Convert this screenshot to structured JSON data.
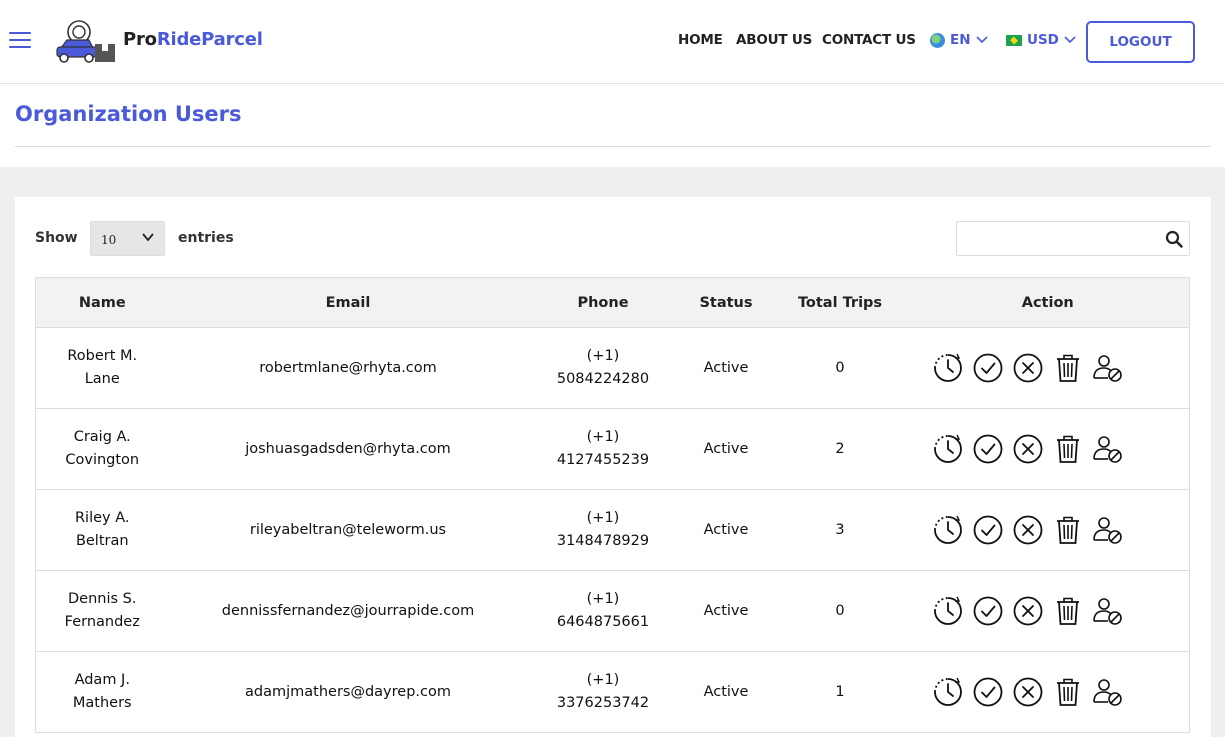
{
  "header": {
    "logo_pre": "Pro",
    "logo_post": "RideParcel",
    "nav": {
      "home": "HOME",
      "about": "ABOUT US",
      "contact": "CONTACT US"
    },
    "language": "EN",
    "currency": "USD",
    "logout": "LOGOUT"
  },
  "page": {
    "title": "Organization Users"
  },
  "controls": {
    "show_label": "Show",
    "entries_value": "10",
    "entries_label": "entries",
    "search_value": ""
  },
  "table": {
    "headers": {
      "name": "Name",
      "email": "Email",
      "phone": "Phone",
      "status": "Status",
      "trips": "Total Trips",
      "action": "Action"
    },
    "rows": [
      {
        "name": "Robert M. Lane",
        "email": "robertmlane@rhyta.com",
        "phone": "(+1) 5084224280",
        "status": "Active",
        "trips": "0"
      },
      {
        "name": "Craig A. Covington",
        "email": "joshuasgadsden@rhyta.com",
        "phone": "(+1) 4127455239",
        "status": "Active",
        "trips": "2"
      },
      {
        "name": "Riley A. Beltran",
        "email": "rileyabeltran@teleworm.us",
        "phone": "(+1) 3148478929",
        "status": "Active",
        "trips": "3"
      },
      {
        "name": "Dennis S. Fernandez",
        "email": "dennissfernandez@jourrapide.com",
        "phone": "(+1) 6464875661",
        "status": "Active",
        "trips": "0"
      },
      {
        "name": "Adam J. Mathers",
        "email": "adamjmathers@dayrep.com",
        "phone": "(+1) 3376253742",
        "status": "Active",
        "trips": "1"
      }
    ]
  },
  "icons": {
    "menu": "hamburger-menu-icon",
    "search": "search-icon",
    "actions": [
      "history-clock-icon",
      "approve-check-icon",
      "reject-x-icon",
      "delete-trash-icon",
      "block-user-icon"
    ]
  },
  "colors": {
    "brand": "#4a5ad8",
    "page_bg": "#efefef",
    "header_row_bg": "#f2f2f2"
  }
}
